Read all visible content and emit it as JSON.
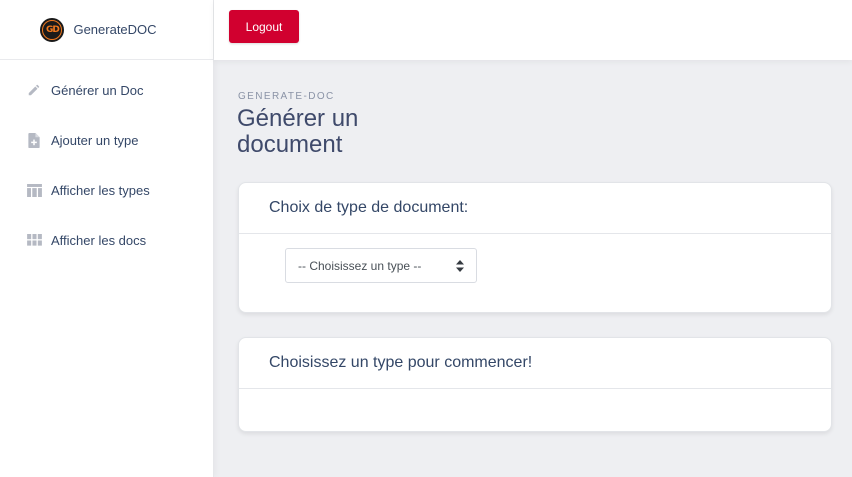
{
  "sidebar": {
    "brand": {
      "name": "GenerateDOC",
      "logo_text": "GD"
    },
    "items": [
      {
        "label": "Générer un Doc",
        "icon": "pencil-icon"
      },
      {
        "label": "Ajouter un type",
        "icon": "file-plus-icon"
      },
      {
        "label": "Afficher les types",
        "icon": "table-icon"
      },
      {
        "label": "Afficher les docs",
        "icon": "grid-icon"
      }
    ]
  },
  "topbar": {
    "logout_label": "Logout"
  },
  "main": {
    "eyebrow": "GENERATE-DOC",
    "title": "Générer un document",
    "type_card": {
      "title": "Choix de type de document:",
      "select": {
        "selected": "-- Choisissez un type --"
      }
    },
    "start_card": {
      "title": "Choisissez un type pour commencer!"
    }
  },
  "colors": {
    "accent": "#d1002f",
    "text": "#344767",
    "background": "#eeeff2",
    "logo": "#f0781e"
  }
}
